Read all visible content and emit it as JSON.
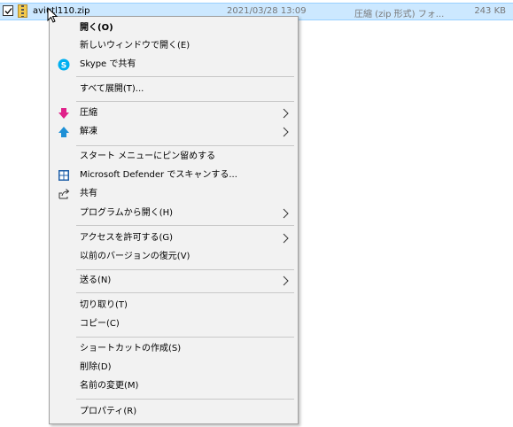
{
  "file_row": {
    "name": "aviutl110.zip",
    "date": "2021/03/28 13:09",
    "type": "圧縮 (zip 形式) フォ...",
    "size": "243 KB"
  },
  "menu": {
    "items": [
      {
        "label": "開く(O)",
        "icon": "",
        "submenu": false
      },
      {
        "label": "新しいウィンドウで開く(E)",
        "icon": "",
        "submenu": false
      },
      {
        "label": "Skype で共有",
        "icon": "skype-icon",
        "submenu": false
      },
      {
        "label": "すべて展開(T)...",
        "icon": "",
        "submenu": false
      },
      {
        "label": "圧縮",
        "icon": "arrow-down-magenta-icon",
        "submenu": true
      },
      {
        "label": "解凍",
        "icon": "arrow-up-blue-icon",
        "submenu": true
      },
      {
        "label": "スタート メニューにピン留めする",
        "icon": "",
        "submenu": false
      },
      {
        "label": "Microsoft Defender でスキャンする...",
        "icon": "defender-icon",
        "submenu": false
      },
      {
        "label": "共有",
        "icon": "share-icon",
        "submenu": false
      },
      {
        "label": "プログラムから開く(H)",
        "icon": "",
        "submenu": true
      },
      {
        "label": "アクセスを許可する(G)",
        "icon": "",
        "submenu": true
      },
      {
        "label": "以前のバージョンの復元(V)",
        "icon": "",
        "submenu": false
      },
      {
        "label": "送る(N)",
        "icon": "",
        "submenu": true
      },
      {
        "label": "切り取り(T)",
        "icon": "",
        "submenu": false
      },
      {
        "label": "コピー(C)",
        "icon": "",
        "submenu": false
      },
      {
        "label": "ショートカットの作成(S)",
        "icon": "",
        "submenu": false
      },
      {
        "label": "削除(D)",
        "icon": "",
        "submenu": false
      },
      {
        "label": "名前の変更(M)",
        "icon": "",
        "submenu": false
      },
      {
        "label": "プロパティ(R)",
        "icon": "",
        "submenu": false
      }
    ]
  },
  "colors": {
    "selection": "#cce8ff",
    "menu_background": "#f2f2f2",
    "compress_arrow": "#e0218a",
    "extract_arrow": "#1e90d6"
  }
}
